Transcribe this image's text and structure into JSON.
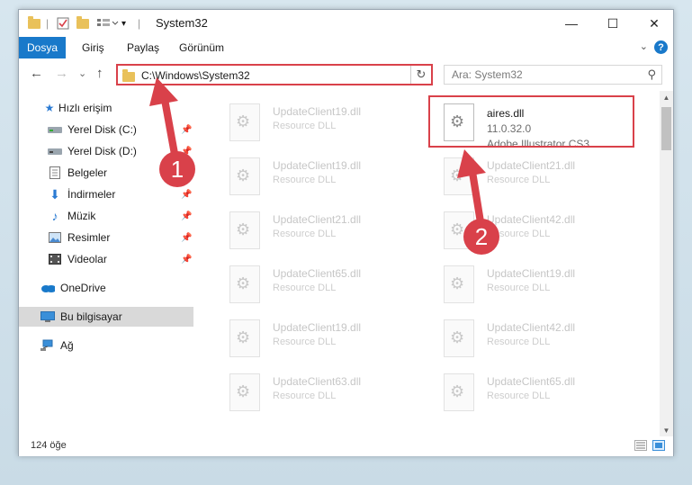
{
  "window": {
    "title": "System32",
    "minimize": "—",
    "maximize": "☐",
    "close": "✕"
  },
  "ribbon": {
    "file_tab": "Dosya",
    "tabs": [
      "Giriş",
      "Paylaş",
      "Görünüm"
    ],
    "help": "?",
    "collapse": "⌄"
  },
  "nav": {
    "back": "←",
    "forward": "→",
    "recent": "⌄",
    "up": "↑",
    "address": "C:\\Windows\\System32",
    "refresh": "↻",
    "search_placeholder": "Ara: System32",
    "search_icon": "⚲"
  },
  "sidebar": {
    "quick_access": "Hızlı erişim",
    "items": [
      {
        "label": "Yerel Disk (C:)",
        "icon": "drive-icon",
        "pinned": true
      },
      {
        "label": "Yerel Disk (D:)",
        "icon": "drive-icon",
        "pinned": true
      },
      {
        "label": "Belgeler",
        "icon": "documents-icon",
        "pinned": true
      },
      {
        "label": "İndirmeler",
        "icon": "download-icon",
        "pinned": true
      },
      {
        "label": "Müzik",
        "icon": "music-icon",
        "pinned": true
      },
      {
        "label": "Resimler",
        "icon": "pictures-icon",
        "pinned": true
      },
      {
        "label": "Videolar",
        "icon": "video-icon",
        "pinned": true
      }
    ],
    "onedrive": "OneDrive",
    "this_pc": "Bu bilgisayar",
    "network": "Ağ"
  },
  "files": [
    {
      "name": "UpdateClient19.dll",
      "type": "Resource DLL"
    },
    {
      "name": "aires.dll",
      "version": "11.0.32.0",
      "description": "Adobe Illustrator CS3",
      "highlighted": true
    },
    {
      "name": "UpdateClient19.dll",
      "type": "Resource DLL"
    },
    {
      "name": "UpdateClient21.dll",
      "type": "Resource DLL"
    },
    {
      "name": "UpdateClient21.dll",
      "type": "Resource DLL"
    },
    {
      "name": "UpdateClient42.dll",
      "type": "Resource DLL"
    },
    {
      "name": "UpdateClient65.dll",
      "type": "Resource DLL"
    },
    {
      "name": "UpdateClient19.dll",
      "type": "Resource DLL"
    },
    {
      "name": "UpdateClient19.dll",
      "type": "Resource DLL"
    },
    {
      "name": "UpdateClient42.dll",
      "type": "Resource DLL"
    },
    {
      "name": "UpdateClient63.dll",
      "type": "Resource DLL"
    },
    {
      "name": "UpdateClient65.dll",
      "type": "Resource DLL"
    }
  ],
  "status": {
    "item_count": "124 öğe"
  },
  "annotations": {
    "badge1": "1",
    "badge2": "2",
    "color": "#d9414a"
  }
}
